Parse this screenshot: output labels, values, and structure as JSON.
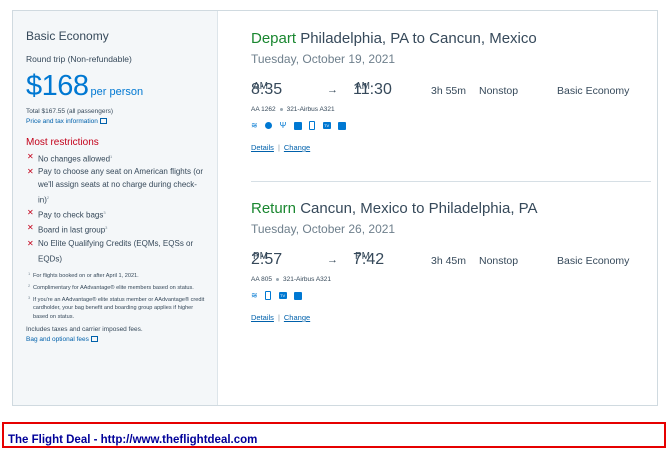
{
  "fare": {
    "type": "Basic Economy",
    "trip": "Round trip (Non-refundable)",
    "price": "$168",
    "per": "per person",
    "total": "Total $167.55 (all passengers)",
    "price_tax_link": "Price and tax information",
    "restrictions_title": "Most restrictions",
    "restrictions": [
      {
        "text": "No changes allowed",
        "note": "1"
      },
      {
        "text": "Pay to choose any seat on American flights (or we'll assign seats at no charge during check-in)",
        "note": "2"
      },
      {
        "text": "Pay to check bags",
        "note": "3"
      },
      {
        "text": "Board in last group",
        "note": "3"
      },
      {
        "text": "No Elite Qualifying Credits (EQMs, EQSs or EQDs)",
        "note": ""
      }
    ],
    "notes": [
      {
        "mark": "1",
        "text": "For flights booked on or after April 1, 2021."
      },
      {
        "mark": "2",
        "text": "Complimentary for AAdvantage® elite members based on status."
      },
      {
        "mark": "3",
        "text": "If you're an AAdvantage® elite status member or AAdvantage® credit cardholder, your bag benefit and boarding group applies if higher based on status."
      }
    ],
    "includes": "Includes taxes and carrier imposed fees.",
    "bag_link": "Bag and optional fees"
  },
  "depart": {
    "label": "Depart",
    "route": "Philadelphia, PA to Cancun, Mexico",
    "date": "Tuesday, October 19, 2021",
    "dep_time": "8:35",
    "dep_ampm": "AM",
    "arrow": "→",
    "arr_time": "11:30",
    "arr_ampm": "AM",
    "duration": "3h 55m",
    "stops": "Nonstop",
    "cabin": "Basic Economy",
    "flight": "AA 1262",
    "aircraft": "321-Airbus A321",
    "amenities": [
      "wifi-icon",
      "shield-icon",
      "power-icon",
      "entertainment-icon",
      "phone-icon",
      "tv-icon",
      "app-icon"
    ],
    "details_link": "Details",
    "change_link": "Change"
  },
  "return": {
    "label": "Return",
    "route": "Cancun, Mexico to Philadelphia, PA",
    "date": "Tuesday, October 26, 2021",
    "dep_time": "2:57",
    "dep_ampm": "PM",
    "arrow": "→",
    "arr_time": "7:42",
    "arr_ampm": "PM",
    "duration": "3h 45m",
    "stops": "Nonstop",
    "cabin": "Basic Economy",
    "flight": "AA 805",
    "aircraft": "321-Airbus A321",
    "amenities": [
      "wifi-icon",
      "phone-icon",
      "tv-icon",
      "app-icon"
    ],
    "details_link": "Details",
    "change_link": "Change"
  },
  "banner": {
    "text": "The Flight Deal - http://www.theflightdeal.com"
  },
  "colors": {
    "accent_blue": "#0078d2",
    "depart_green": "#1a8730",
    "restriction_red": "#c30019",
    "banner_border": "#e60000",
    "banner_text": "#000099"
  }
}
